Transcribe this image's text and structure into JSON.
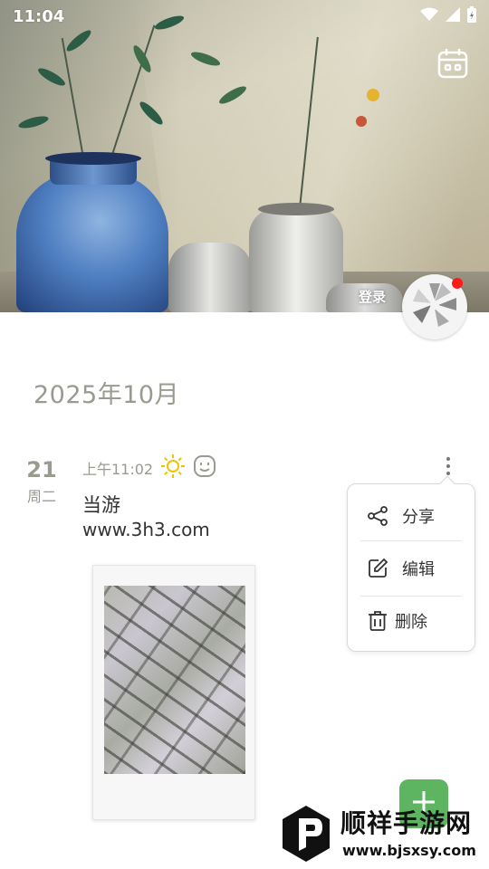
{
  "status_bar": {
    "time": "11:04",
    "icons": [
      "wifi-icon",
      "signal-icon",
      "battery-charging-icon"
    ]
  },
  "header": {
    "calendar_icon": "calendar-icon",
    "login_label": "登录",
    "avatar_icon": "flower-avatar-icon",
    "notification_dot_color": "#ff1a1a"
  },
  "timeline": {
    "month_title": "2025年10月",
    "entry": {
      "day": "21",
      "weekday": "周二",
      "time": "上午11:02",
      "weather_icon": "sun-icon",
      "mood_icon": "smile-face-icon",
      "title": "当游",
      "url": "www.3h3.com",
      "photo_icon": "photo-image"
    }
  },
  "context_menu": {
    "items": [
      {
        "label": "分享",
        "icon": "share-icon"
      },
      {
        "label": "编辑",
        "icon": "edit-icon"
      },
      {
        "label": "删除",
        "icon": "trash-icon"
      }
    ]
  },
  "fab": {
    "icon": "plus-icon",
    "color": "#5db561"
  },
  "watermark": {
    "name": "顺祥手游网",
    "url": "www.bjsxsy.com"
  },
  "colors": {
    "muted_text": "#9a9a90",
    "accent_green": "#5db561",
    "sun_yellow": "#f2c200"
  }
}
